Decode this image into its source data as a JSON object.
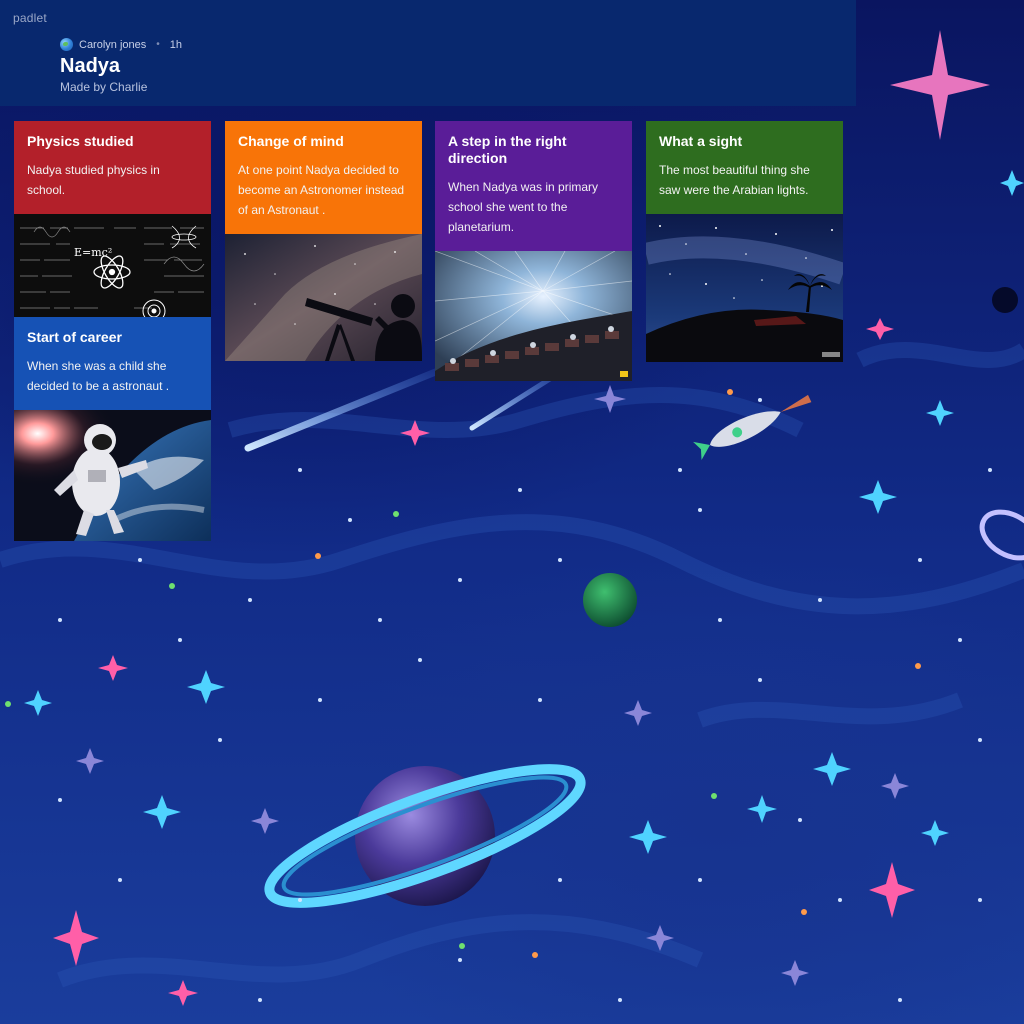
{
  "header": {
    "brand": "padlet",
    "author": "Carolyn jones",
    "time": "1h",
    "title": "Nadya",
    "subtitle": "Made by Charlie"
  },
  "cards": [
    {
      "title": "Physics studied",
      "body": "Nadya studied physics in school.",
      "color": "#b3202a",
      "image": "physics-equations-image",
      "image_text": "E=mc²"
    },
    {
      "title": "Change of mind",
      "body": "At one point Nadya decided  to become an Astronomer instead of an Astronaut .",
      "color": "#f87408",
      "image": "telescope-silhouette-image"
    },
    {
      "title": "A step in the right direction",
      "body": "When Nadya was in primary school she went to the planetarium.",
      "color": "#5a1d98",
      "image": "planetarium-dome-image"
    },
    {
      "title": "What a sight",
      "body": "The most beautiful thing she saw were the Arabian lights.",
      "color": "#2e6d1f",
      "image": "desert-night-sky-image"
    },
    {
      "title": "Start of career",
      "body": "When she was a child she decided to be a astronaut .",
      "color": "#1652b5",
      "image": "astronaut-spacewalk-image"
    }
  ],
  "background": {
    "theme": "space-wallpaper",
    "colors": [
      "#0a1560",
      "#1a3d9c"
    ]
  }
}
